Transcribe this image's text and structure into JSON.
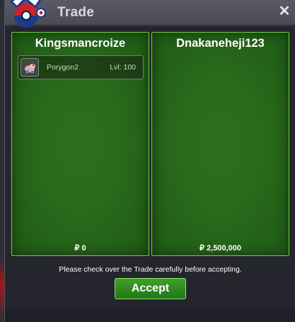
{
  "window": {
    "title": "Trade",
    "close_icon": "close-icon",
    "logo_icon": "pokeball-logo-icon"
  },
  "trade": {
    "left": {
      "player_name": "Kingsmancroize",
      "items": [
        {
          "icon": "porygon2-sprite-icon",
          "name": "Porygon2",
          "level": "Lvl: 100"
        }
      ],
      "money": "₽ 0"
    },
    "right": {
      "player_name": "Dnakaneheji123",
      "items": [],
      "money": "₽ 2,500,000"
    }
  },
  "notice": "Please check over the Trade carefully before accepting.",
  "accept_label": "Accept",
  "colors": {
    "panel_green": "#2a6a1c",
    "panel_border": "#6fd04a",
    "button_green": "#3fa02a"
  }
}
